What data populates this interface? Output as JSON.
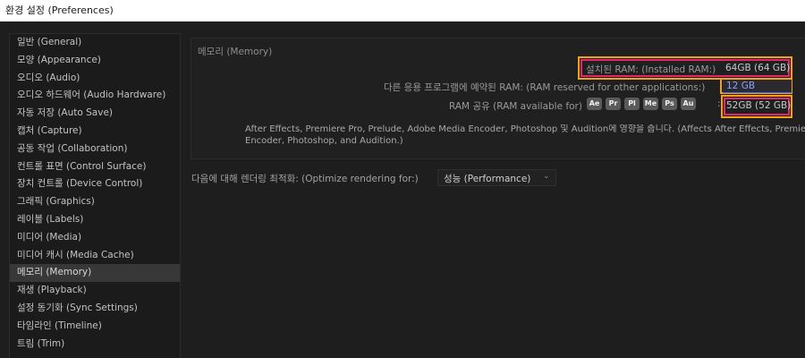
{
  "window": {
    "title": "환경 설정 (Preferences)"
  },
  "sidebar": {
    "items": [
      {
        "label": "일반 (General)"
      },
      {
        "label": "모양 (Appearance)"
      },
      {
        "label": "오디오 (Audio)"
      },
      {
        "label": "오디오 하드웨어 (Audio Hardware)"
      },
      {
        "label": "자동 저장 (Auto Save)"
      },
      {
        "label": "캡처 (Capture)"
      },
      {
        "label": "공동 작업 (Collaboration)"
      },
      {
        "label": "컨트롤 표면 (Control Surface)"
      },
      {
        "label": "장치 컨트롤 (Device Control)"
      },
      {
        "label": "그래픽 (Graphics)"
      },
      {
        "label": "레이블 (Labels)"
      },
      {
        "label": "미디어 (Media)"
      },
      {
        "label": "미디어 캐시 (Media Cache)"
      },
      {
        "label": "메모리 (Memory)",
        "selected": true
      },
      {
        "label": "재생 (Playback)"
      },
      {
        "label": "설정 동기화 (Sync Settings)"
      },
      {
        "label": "타임라인 (Timeline)"
      },
      {
        "label": "트림 (Trim)"
      }
    ]
  },
  "memory": {
    "section_title": "메모리 (Memory)",
    "installed_label": "설치된 RAM: (Installed RAM:)",
    "installed_value": "64GB (64 GB)",
    "reserved_label": "다른 응용 프로그램에 예약된 RAM: (RAM reserved for other applications:)",
    "reserved_value": "12 GB",
    "available_label": "RAM 공유 (RAM available for)",
    "available_value": "52GB (52 GB)",
    "apps": [
      {
        "abbr": "Ae",
        "icon": "after-effects-icon"
      },
      {
        "abbr": "Pr",
        "icon": "premiere-pro-icon"
      },
      {
        "abbr": "Pl",
        "icon": "prelude-icon"
      },
      {
        "abbr": "Me",
        "icon": "media-encoder-icon"
      },
      {
        "abbr": "Ps",
        "icon": "photoshop-icon"
      },
      {
        "abbr": "Au",
        "icon": "audition-icon"
      }
    ],
    "colon": ":",
    "affects_text": "After Effects, Premiere Pro, Prelude, Adobe Media Encoder, Photoshop 및 Audition에 영향을 줍니다. (Affects After Effects, Premiere Pro, Prelude, Adobe Media\nEncoder, Photoshop, and Audition.)"
  },
  "render": {
    "label": "다음에 대해 렌더링 최적화: (Optimize rendering for:)",
    "selected": "성능 (Performance)"
  },
  "colors": {
    "highlight_orange": "#f2a020",
    "highlight_pink": "#e0286c",
    "panel_bg": "#1e1e1e",
    "selected_item_bg": "#383838"
  }
}
